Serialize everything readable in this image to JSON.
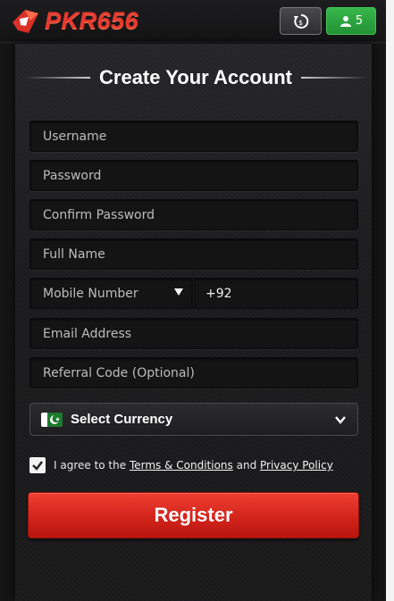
{
  "brand": {
    "name": "PKR656",
    "primary_color": "#e53a2f",
    "accent_green": "#2ea541"
  },
  "header": {
    "wallet_button_icon": "refresh-wallet-icon",
    "user_count": "5",
    "user_icon": "user-icon"
  },
  "form": {
    "title": "Create Your Account",
    "fields": {
      "username": "Username",
      "password": "Password",
      "confirm_password": "Confirm Password",
      "full_name": "Full Name",
      "mobile_number": "Mobile Number",
      "country_code": "+92",
      "email": "Email Address",
      "referral": "Referral Code (Optional)"
    },
    "currency": {
      "label": "Select Currency",
      "flag_icon": "pakistan-flag-icon"
    },
    "agree": {
      "checked": true,
      "prefix": "I agree to the ",
      "terms_link": "Terms & Conditions",
      "and": " and ",
      "privacy_link": "Privacy Policy"
    },
    "register_label": "Register"
  }
}
